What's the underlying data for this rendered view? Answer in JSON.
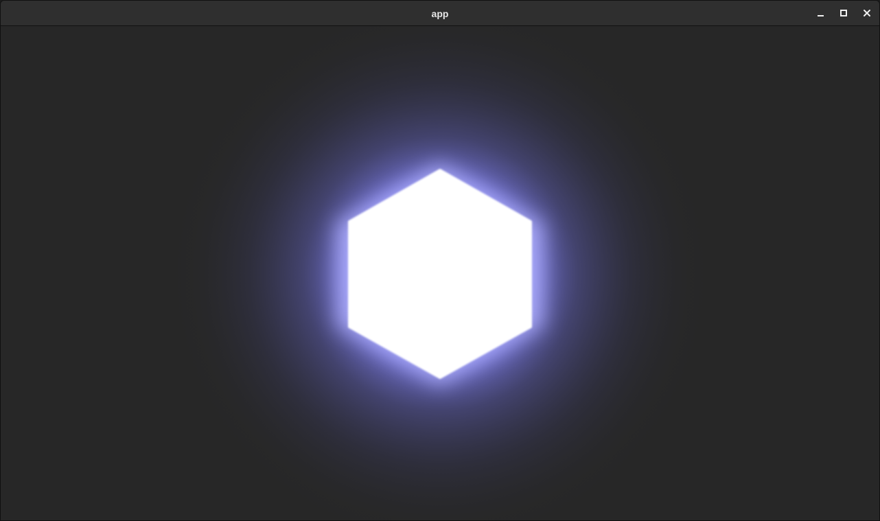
{
  "window": {
    "title": "app",
    "controls": {
      "minimize_icon": "minimize-icon",
      "maximize_icon": "maximize-icon",
      "close_icon": "close-icon"
    }
  },
  "scene": {
    "shape": "hexagon",
    "core_color": "#ffffff",
    "glow_color": "#8f8fff",
    "background_color": "#272727"
  }
}
